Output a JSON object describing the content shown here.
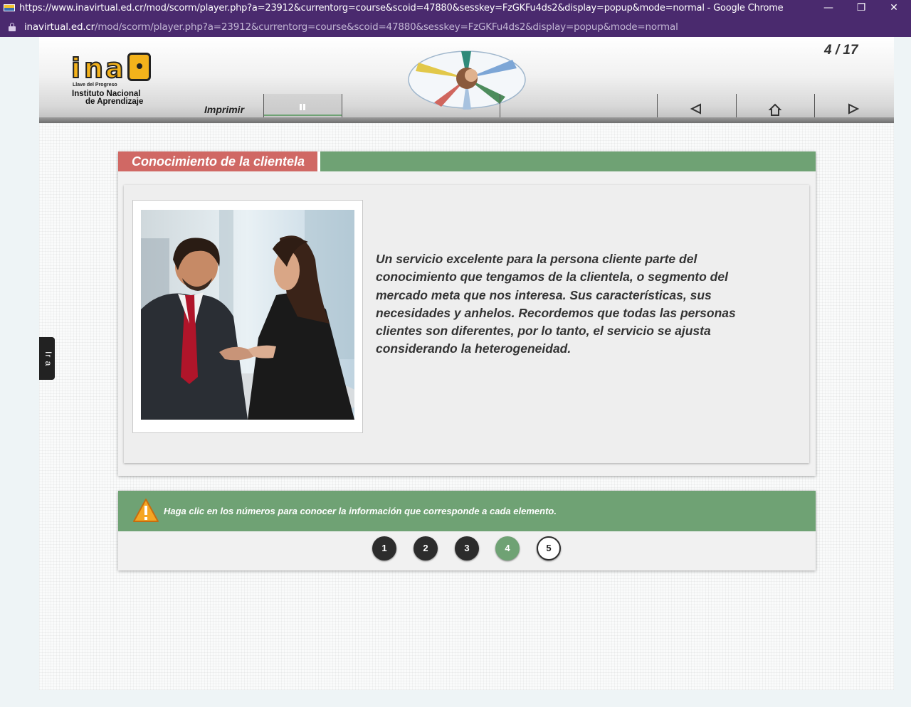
{
  "window": {
    "title": "https://www.inavirtual.ed.cr/mod/scorm/player.php?a=23912&currentorg=course&scoid=47880&sesskey=FzGKFu4ds2&display=popup&mode=normal - Google Chrome",
    "minimize_glyph": "—",
    "restore_glyph": "❐",
    "close_glyph": "✕"
  },
  "address_bar": {
    "host": "inavirtual.ed.cr",
    "path": "/mod/scorm/player.php?a=23912&currentorg=course&scoid=47880&sesskey=FzGKFu4ds2&display=popup&mode=normal"
  },
  "header": {
    "logo": {
      "letters": [
        "i",
        "n",
        "a"
      ],
      "tagline": "Llave del Progreso",
      "name_line1": "Instituto Nacional",
      "name_line2": "de Aprendizaje"
    },
    "page_counter": "4 / 17",
    "print_label": "Imprimir",
    "nav": [
      "previous-icon",
      "home-icon",
      "next-icon"
    ]
  },
  "side_tab": {
    "label": "Ir a"
  },
  "content": {
    "title": "Conocimiento de la clientela",
    "body": "Un servicio excelente para la persona cliente parte del conocimiento que tengamos de la clientela, o segmento del mercado meta que nos interesa. Sus características, sus necesidades y anhelos. Recordemos que todas las personas clientes son diferentes, por lo tanto, el servicio se ajusta considerando la heterogeneidad."
  },
  "instructions": {
    "text": "Haga clic en los números para conocer la información que corresponde a cada elemento.",
    "numbers": [
      {
        "label": "1",
        "state": "visited"
      },
      {
        "label": "2",
        "state": "visited"
      },
      {
        "label": "3",
        "state": "visited"
      },
      {
        "label": "4",
        "state": "active"
      },
      {
        "label": "5",
        "state": "unvisited"
      }
    ]
  },
  "colors": {
    "chrome_purple": "#4a2a6e",
    "accent_green": "#6fa274",
    "title_red": "#d06864",
    "logo_yellow": "#f3b21b"
  }
}
